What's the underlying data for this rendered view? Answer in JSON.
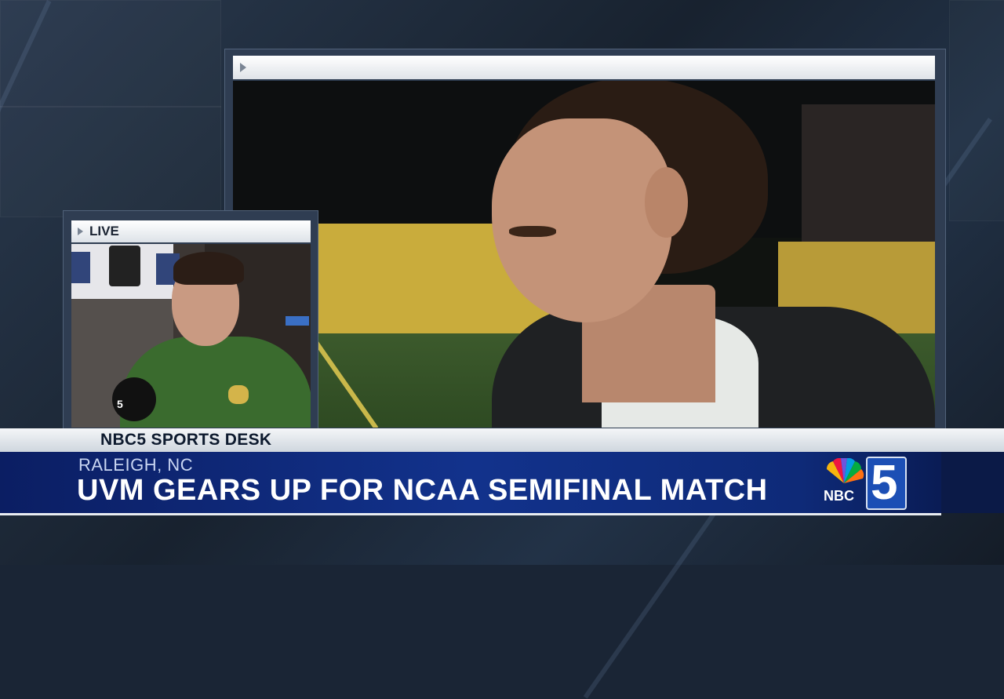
{
  "live_inset": {
    "label": "LIVE",
    "mic_flag": "5"
  },
  "lower_third": {
    "desk_title": "NBC5 SPORTS DESK",
    "location": "RALEIGH, NC",
    "headline": "UVM GEARS UP FOR NCAA SEMIFINAL MATCH"
  },
  "logo": {
    "network": "NBC",
    "channel": "5"
  },
  "colors": {
    "headline_bar": "#12328c",
    "desk_bar": "#f4f6f8",
    "background": "#1a2535"
  }
}
